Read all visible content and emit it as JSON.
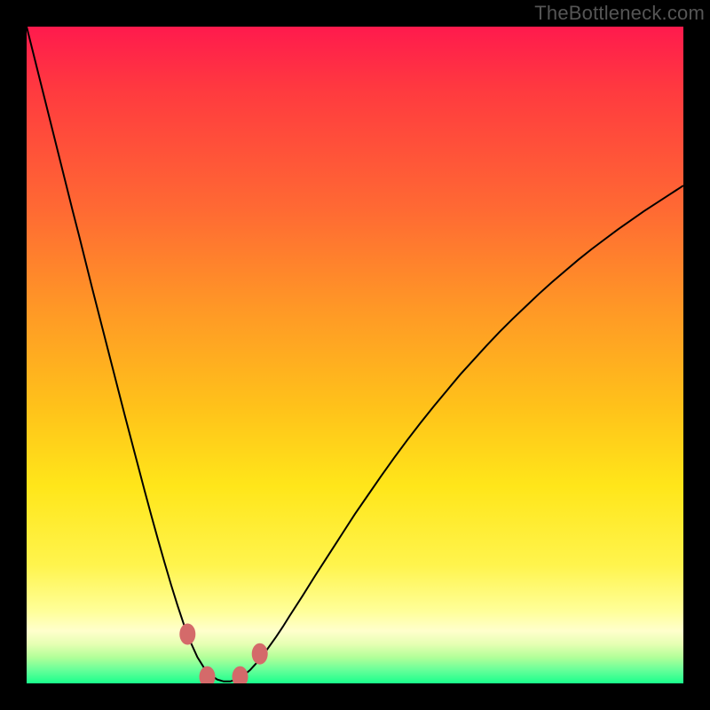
{
  "watermark": "TheBottleneck.com",
  "colors": {
    "frame": "#000000",
    "gradient_top": "#ff1a4d",
    "gradient_bottom": "#1aff8c",
    "curve": "#000000",
    "marker": "#d46a6a"
  },
  "chart_data": {
    "type": "line",
    "title": "",
    "xlabel": "",
    "ylabel": "",
    "xlim": [
      0,
      100
    ],
    "ylim": [
      0,
      100
    ],
    "x": [
      0,
      1,
      2,
      3,
      4,
      5,
      6,
      7,
      8,
      9,
      10,
      11,
      12,
      13,
      14,
      15,
      16,
      17,
      18,
      19,
      20,
      21,
      22,
      23,
      24,
      25,
      26,
      27,
      28,
      29,
      30,
      31,
      32,
      33,
      34,
      35,
      36,
      37,
      38,
      39,
      40,
      42,
      44,
      46,
      48,
      50,
      52,
      54,
      56,
      58,
      60,
      62,
      64,
      66,
      68,
      70,
      72,
      74,
      76,
      78,
      80,
      82,
      84,
      86,
      88,
      90,
      92,
      94,
      96,
      98,
      100
    ],
    "values": [
      100,
      96.0,
      92.0,
      88.0,
      84.0,
      80.0,
      76.0,
      72.0,
      68.1,
      64.1,
      60.1,
      56.2,
      52.3,
      48.4,
      44.5,
      40.6,
      36.8,
      33.0,
      29.2,
      25.5,
      21.9,
      18.4,
      15.0,
      11.8,
      8.8,
      6.2,
      4.0,
      2.4,
      1.3,
      0.6,
      0.3,
      0.3,
      0.6,
      1.2,
      2.0,
      3.1,
      4.3,
      5.7,
      7.1,
      8.6,
      10.2,
      13.3,
      16.5,
      19.6,
      22.7,
      25.8,
      28.7,
      31.6,
      34.4,
      37.1,
      39.7,
      42.2,
      44.6,
      47.0,
      49.2,
      51.4,
      53.5,
      55.5,
      57.4,
      59.3,
      61.1,
      62.8,
      64.5,
      66.1,
      67.6,
      69.1,
      70.5,
      71.9,
      73.2,
      74.5,
      75.8
    ],
    "markers_x": [
      24.5,
      27.5,
      32.5,
      35.5
    ],
    "markers_y": [
      7.5,
      1.0,
      1.0,
      4.5
    ],
    "annotations": []
  }
}
